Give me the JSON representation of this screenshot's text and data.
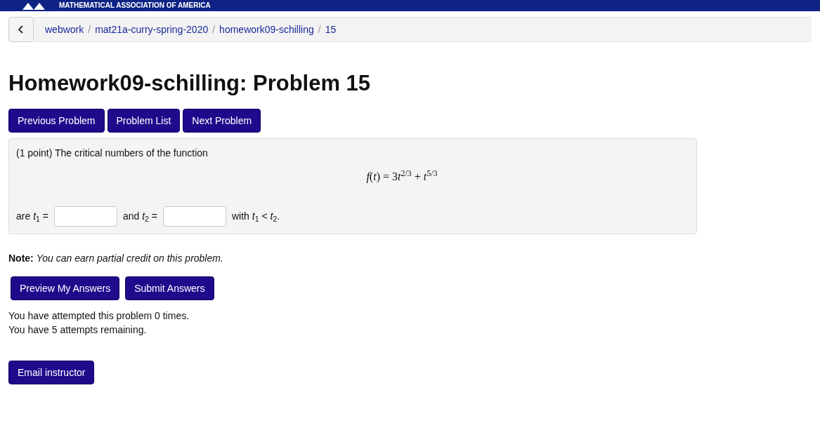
{
  "banner": {
    "text": "MATHEMATICAL ASSOCIATION OF AMERICA"
  },
  "breadcrumb_separator": "/",
  "breadcrumb": [
    {
      "label": "webwork"
    },
    {
      "label": "mat21a-curry-spring-2020"
    },
    {
      "label": "homework09-schilling"
    },
    {
      "label": "15"
    }
  ],
  "title": "Homework09-schilling: Problem 15",
  "nav_buttons": [
    "Previous Problem",
    "Problem List",
    "Next Problem"
  ],
  "problem": {
    "intro": "(1 point) The critical numbers of the function",
    "formula": [
      "*f*(*t*) = 3",
      "*t*$^{2/3}$ + *t*$^{5/3}$"
    ],
    "answer_line": [
      {
        "kind": "text",
        "text": "are *t*$_{1}$ ="
      },
      {
        "kind": "input"
      },
      {
        "kind": "text",
        "text": "and *t*$_{2}$ ="
      },
      {
        "kind": "input"
      },
      {
        "kind": "text",
        "text": "with *t*$_{1}$ < *t*$_{2}$."
      }
    ]
  },
  "note": "**Note:** *You can earn partial credit on this problem.*",
  "answer_buttons": [
    "Preview My Answers",
    "Submit Answers"
  ],
  "attempts": [
    "You have attempted this problem 0 times.",
    "You have 5 attempts remaining."
  ],
  "email_button": "Email instructor"
}
